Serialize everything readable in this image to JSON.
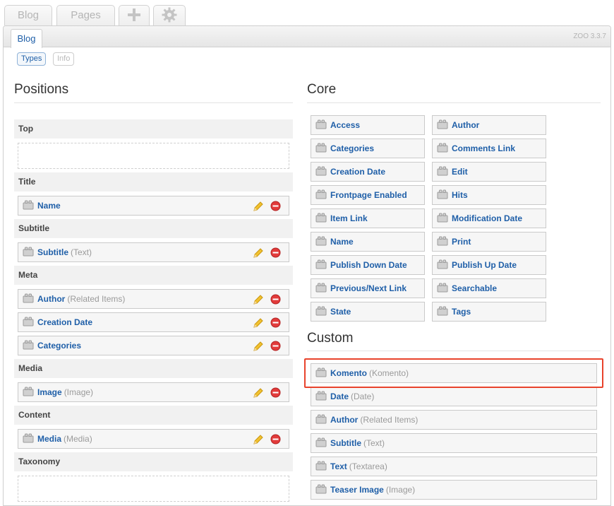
{
  "top_tabs": [
    {
      "label": "Blog"
    },
    {
      "label": "Pages"
    },
    {
      "icon": "plus-icon"
    },
    {
      "icon": "gear-icon"
    }
  ],
  "panel": {
    "subtab": "Blog",
    "version": "ZOO 3.3.7",
    "pills": {
      "types": "Types",
      "info": "Info"
    }
  },
  "positions": {
    "title": "Positions",
    "groups": {
      "top": "Top",
      "title": "Title",
      "subtitle": "Subtitle",
      "meta": "Meta",
      "media": "Media",
      "content": "Content",
      "taxonomy": "Taxonomy"
    },
    "elements": [
      {
        "name": "Name",
        "type": ""
      },
      {
        "name": "Subtitle",
        "type": "(Text)"
      },
      {
        "name": "Author",
        "type": "(Related Items)"
      },
      {
        "name": "Creation Date",
        "type": ""
      },
      {
        "name": "Categories",
        "type": ""
      },
      {
        "name": "Image",
        "type": "(Image)"
      },
      {
        "name": "Media",
        "type": "(Media)"
      }
    ]
  },
  "core": {
    "title": "Core",
    "elements": [
      "Access",
      "Author",
      "Categories",
      "Comments Link",
      "Creation Date",
      "Edit",
      "Frontpage Enabled",
      "Hits",
      "Item Link",
      "Modification Date",
      "Name",
      "Print",
      "Publish Down Date",
      "Publish Up Date",
      "Previous/Next Link",
      "Searchable",
      "State",
      "Tags"
    ]
  },
  "custom": {
    "title": "Custom",
    "elements": [
      {
        "name": "Komento",
        "type": "(Komento)"
      },
      {
        "name": "Date",
        "type": "(Date)"
      },
      {
        "name": "Author",
        "type": "(Related Items)"
      },
      {
        "name": "Subtitle",
        "type": "(Text)"
      },
      {
        "name": "Text",
        "type": "(Textarea)"
      },
      {
        "name": "Teaser Image",
        "type": "(Image)"
      }
    ]
  },
  "colors": {
    "link": "#1f5fa8",
    "highlight": "#e8432c",
    "label_bg": "#f1f1f1"
  }
}
